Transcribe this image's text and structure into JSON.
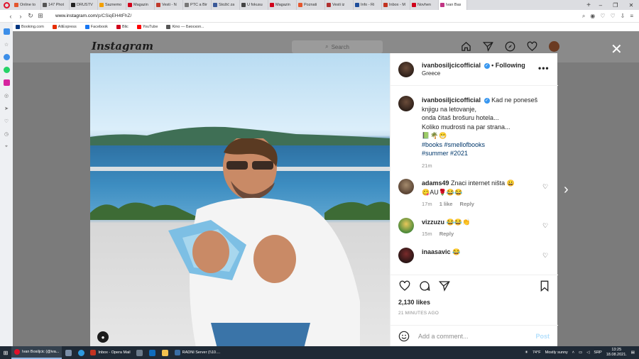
{
  "browser": {
    "tabs": [
      {
        "label": "Online to",
        "color": "#e4572e"
      },
      {
        "label": "147 Phot",
        "color": "#555555"
      },
      {
        "label": "DRUŠTV",
        "color": "#222222"
      },
      {
        "label": "Saznemo",
        "color": "#f3a000"
      },
      {
        "label": "Magazin",
        "color": "#d0021b"
      },
      {
        "label": "Vesti - N",
        "color": "#c0392b"
      },
      {
        "label": "PTC a Bir",
        "color": "#777777"
      },
      {
        "label": "Stožić za",
        "color": "#3b5998"
      },
      {
        "label": "U fokusu",
        "color": "#444444"
      },
      {
        "label": "Magazin",
        "color": "#d0021b"
      },
      {
        "label": "Poznati",
        "color": "#e4572e"
      },
      {
        "label": "Vesti iz",
        "color": "#b03030"
      },
      {
        "label": "Info - Ri",
        "color": "#1f4e9b"
      },
      {
        "label": "Inbox - M",
        "color": "#c23321"
      },
      {
        "label": "Novhen",
        "color": "#d0021b"
      },
      {
        "label": "Ivan Bas",
        "color": "#c13584",
        "active": true
      }
    ],
    "new_tab": "+",
    "url_prefix": "www.instagram.com",
    "url_path": "/p/CSiqEH4tFhZ/",
    "bookmarks": [
      {
        "label": "Booking.com",
        "color": "#003580"
      },
      {
        "label": "AliExpress",
        "color": "#e62e04"
      },
      {
        "label": "Facebook",
        "color": "#1877f2"
      },
      {
        "label": "Blic",
        "color": "#d0021b"
      },
      {
        "label": "YouTube",
        "color": "#ff0000"
      },
      {
        "label": "Kino — Биоскоп...",
        "color": "#555555"
      }
    ]
  },
  "instagram": {
    "logo": "Instagram",
    "search_placeholder": "Search"
  },
  "post": {
    "username": "ivanbosiljcicofficial",
    "follow_status": "Following",
    "location": "Greece",
    "caption_lines": [
      "Kad ne poneseš",
      "knjigu na letovanje,",
      "onda čitaš brošuru hotela...",
      "Koliko mudrosti na par strana..."
    ],
    "caption_emojis": "📗🌴😁",
    "hashtags_line1": "#books #smellofbooks",
    "hashtags_line2": "#summer #2021",
    "caption_time": "21m",
    "likes": "2,130 likes",
    "posted_ago": "21 MINUTES AGO",
    "comment_placeholder": "Add a comment...",
    "post_button": "Post"
  },
  "comments": [
    {
      "user": "adams49",
      "text": "Znaci internet ništa 😀",
      "text2": "😋AU🌹😂😂",
      "time": "17m",
      "likes": "1 like",
      "reply": "Reply"
    },
    {
      "user": "vizzuzu",
      "text": "😂😂👏",
      "time": "15m",
      "reply": "Reply"
    },
    {
      "user": "inaasavic",
      "text": "😂"
    }
  ],
  "taskbar": {
    "items": [
      {
        "label": "Ivan Bosiljcic (@iva...",
        "color": "#e0102a",
        "active": true
      },
      {
        "label": "Inbox - Opera Mail",
        "color": "#c23321",
        "active": false
      },
      {
        "label": "RADNI Server (\\\\10....",
        "color": "#3a6ea5",
        "active": false
      }
    ],
    "weather_temp": "74°F",
    "weather_desc": "Mostly sunny",
    "language": "SRP",
    "time": "13:25",
    "date": "18.08.2021."
  }
}
